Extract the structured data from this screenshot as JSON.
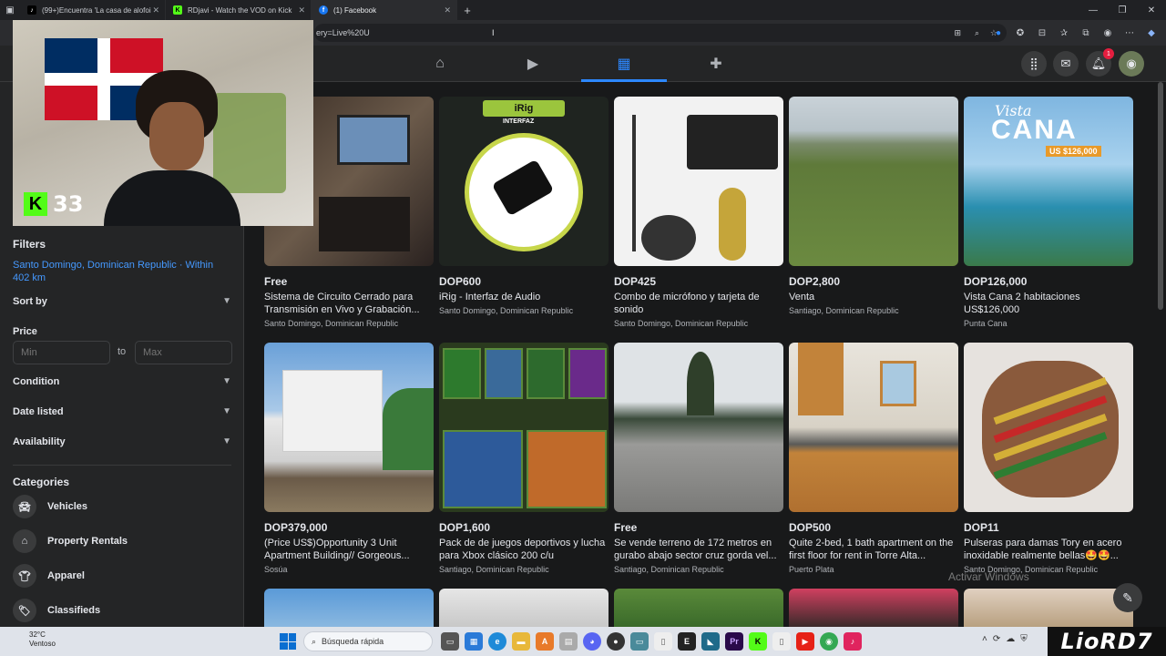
{
  "browser": {
    "tabs": [
      {
        "label": "(99+)Encuentra 'La casa de alofoi",
        "active": false
      },
      {
        "label": "RDjavi - Watch the VOD on Kick",
        "active": false
      },
      {
        "label": "(1) Facebook",
        "active": true
      }
    ],
    "url": "ery=Live%20U"
  },
  "stream": {
    "viewer_count": "33"
  },
  "nav": {
    "notification_count": "1"
  },
  "filters": {
    "title": "Filters",
    "location": "Santo Domingo, Dominican Republic · Within 402 km",
    "sort_by": "Sort by",
    "price_label": "Price",
    "min_placeholder": "Min",
    "max_placeholder": "Max",
    "to_label": "to",
    "condition": "Condition",
    "date_listed": "Date listed",
    "availability": "Availability"
  },
  "categories": {
    "title": "Categories",
    "items": [
      {
        "label": "Vehicles",
        "icon": "car-icon"
      },
      {
        "label": "Property Rentals",
        "icon": "house-icon"
      },
      {
        "label": "Apparel",
        "icon": "shirt-icon"
      },
      {
        "label": "Classifieds",
        "icon": "tag-icon"
      }
    ]
  },
  "listings": [
    {
      "price": "Free",
      "title": "Sistema de Circuito Cerrado para Transmisión en Vivo y Grabación...",
      "location": "Santo Domingo, Dominican Republic"
    },
    {
      "price": "DOP600",
      "title": "iRig - Interfaz de Audio",
      "location": "Santo Domingo, Dominican Republic",
      "img_text": "iRig",
      "img_sub": "INTERFAZ"
    },
    {
      "price": "DOP425",
      "title": "Combo de micrófono y tarjeta de sonido",
      "location": "Santo Domingo, Dominican Republic"
    },
    {
      "price": "DOP2,800",
      "title": "Venta",
      "location": "Santiago, Dominican Republic"
    },
    {
      "price": "DOP126,000",
      "title": "Vista Cana 2 habitaciones US$126,000",
      "location": "Punta Cana",
      "img_text": "CANA",
      "img_script": "Vista",
      "img_price": "US $126,000"
    },
    {
      "price": "DOP379,000",
      "title": "(Price US$)Opportunity 3 Unit Apartment Building// Gorgeous...",
      "location": "Sosúa"
    },
    {
      "price": "DOP1,600",
      "title": "Pack de de juegos deportivos y lucha para Xbox clásico 200 c/u",
      "location": "Santiago, Dominican Republic"
    },
    {
      "price": "Free",
      "title": "Se vende terreno de 172 metros en gurabo abajo sector cruz gorda vel...",
      "location": "Santiago, Dominican Republic"
    },
    {
      "price": "DOP500",
      "title": "Quite 2-bed, 1 bath apartment on the first floor for rent in Torre Alta...",
      "location": "Puerto Plata"
    },
    {
      "price": "DOP11",
      "title": "Pulseras para damas Tory en acero inoxidable realmente bellas🤩🤩...",
      "location": "Santo Domingo, Dominican Republic"
    }
  ],
  "watermark": "Activar Windows",
  "taskbar": {
    "temp": "32°C",
    "weather": "Ventoso",
    "search_placeholder": "Búsqueda rápida",
    "tag": "LioRD7"
  }
}
